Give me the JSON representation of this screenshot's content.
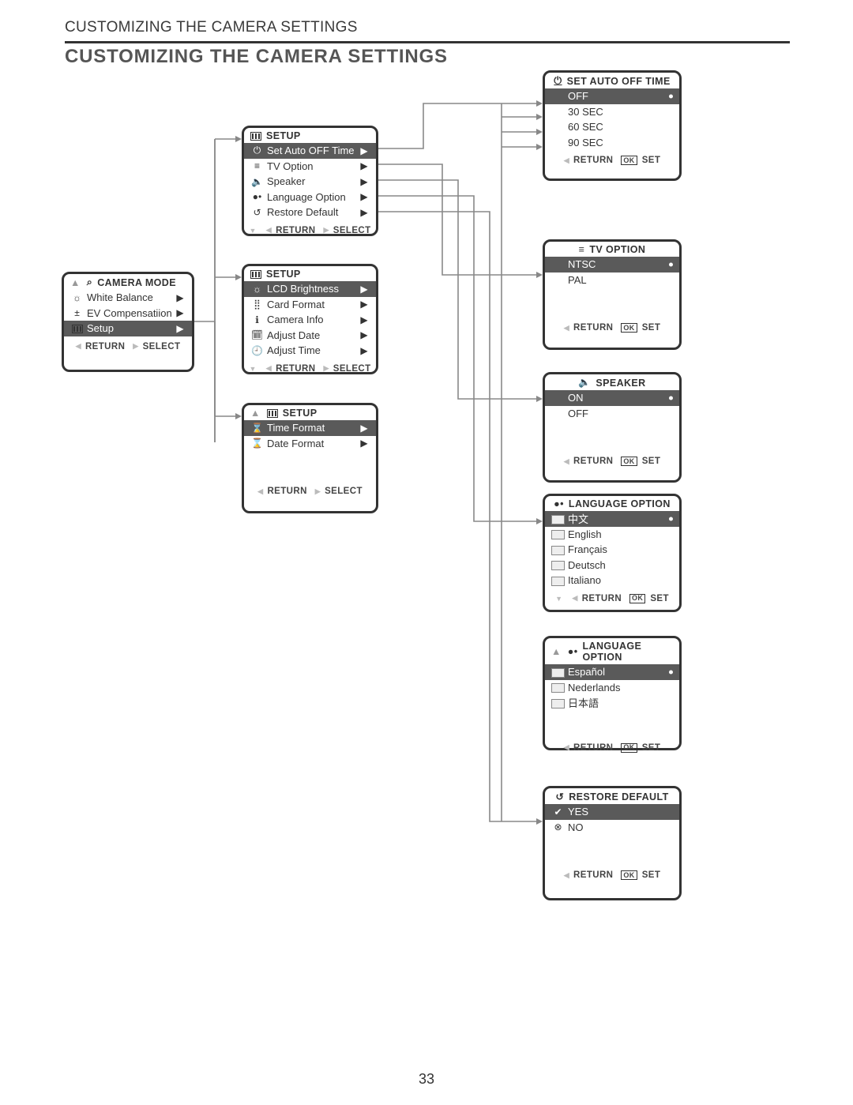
{
  "header": {
    "running": "CUSTOMIZING THE CAMERA SETTINGS",
    "title": "CUSTOMIZING THE CAMERA SETTINGS"
  },
  "footer_actions": {
    "return": "RETURN",
    "select": "SELECT",
    "set": "SET",
    "ok": "OK"
  },
  "camera_mode": {
    "title": "CAMERA  MODE",
    "items": [
      {
        "icon": "☼",
        "label": "White Balance"
      },
      {
        "icon": "±",
        "label": "EV Compensatiion"
      },
      {
        "icon": "slider",
        "label": "Setup",
        "selected": true
      }
    ]
  },
  "setup1": {
    "title": "SETUP",
    "items": [
      {
        "icon": "⏻",
        "label": "Set Auto OFF Time",
        "selected": true
      },
      {
        "icon": "≡",
        "label": "TV Option"
      },
      {
        "icon": "🔈",
        "label": "Speaker"
      },
      {
        "icon": "●•",
        "label": "Language Option"
      },
      {
        "icon": "↺",
        "label": "Restore Default"
      }
    ]
  },
  "setup2": {
    "title": "SETUP",
    "items": [
      {
        "icon": "☼",
        "label": "LCD Brightness",
        "selected": true
      },
      {
        "icon": "⣿",
        "label": "Card Format"
      },
      {
        "icon": "ℹ",
        "label": "Camera Info"
      },
      {
        "icon": "🗓",
        "label": "Adjust Date"
      },
      {
        "icon": "🕘",
        "label": "Adjust Time"
      }
    ]
  },
  "setup3": {
    "title": "SETUP",
    "items": [
      {
        "icon": "⌛",
        "label": "Time Format",
        "selected": true
      },
      {
        "icon": "⌛",
        "label": "Date Format"
      }
    ]
  },
  "auto_off": {
    "title": "SET AUTO OFF TIME",
    "items": [
      {
        "label": "OFF",
        "selected": true
      },
      {
        "label": "30 SEC"
      },
      {
        "label": "60 SEC"
      },
      {
        "label": "90 SEC"
      }
    ]
  },
  "tv_option": {
    "title": "TV  OPTION",
    "icon": "≡",
    "items": [
      {
        "label": "NTSC",
        "selected": true
      },
      {
        "label": "PAL"
      }
    ]
  },
  "speaker": {
    "title": "SPEAKER",
    "icon": "🔈",
    "items": [
      {
        "label": "ON",
        "selected": true
      },
      {
        "label": "OFF"
      }
    ]
  },
  "language1": {
    "title": "LANGUAGE  OPTION",
    "icon": "●•",
    "items": [
      {
        "flag": true,
        "label": "中文",
        "selected": true
      },
      {
        "flag": true,
        "label": "English"
      },
      {
        "flag": true,
        "label": "Français"
      },
      {
        "flag": true,
        "label": "Deutsch"
      },
      {
        "flag": true,
        "label": "Italiano"
      }
    ]
  },
  "language2": {
    "title": "LANGUAGE  OPTION",
    "icon": "●•",
    "items": [
      {
        "flag": true,
        "label": "Español",
        "selected": true
      },
      {
        "flag": true,
        "label": "Nederlands"
      },
      {
        "flag": true,
        "label": "日本語"
      }
    ]
  },
  "restore": {
    "title": "RESTORE  DEFAULT",
    "icon": "↺",
    "items": [
      {
        "icon": "✔",
        "label": "YES",
        "selected": true
      },
      {
        "icon": "⊗",
        "label": "NO"
      }
    ]
  },
  "page_number": "33"
}
